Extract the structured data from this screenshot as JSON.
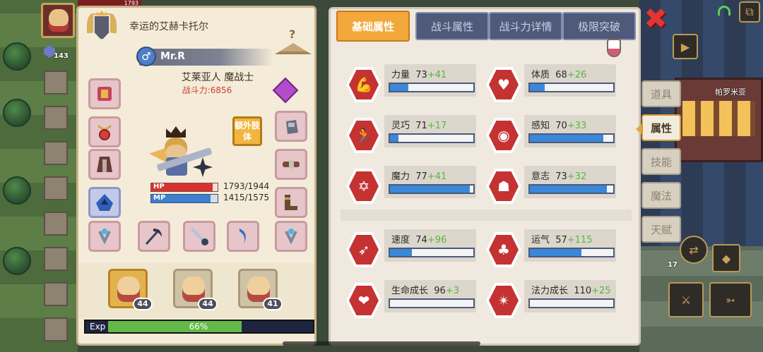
{
  "hud": {
    "top_hp_text": "1793",
    "level_badge": "143",
    "gold_count": "17",
    "map_label": "帕罗米亚"
  },
  "character": {
    "title": "幸运的艾赫卡托尔",
    "gender_symbol": "♂",
    "name": "Mr.R",
    "race_class": "艾莱亚人 魔战士",
    "power_label": "战斗力:6856",
    "extra_limb_label": "额外肢体",
    "hanger_symbol": "?",
    "hp_label": "HP",
    "hp_value": "1793/1944",
    "hp_fraction": 0.922,
    "mp_label": "MP",
    "mp_value": "1415/1575",
    "mp_fraction": 0.898,
    "party": [
      {
        "level": "44",
        "active": true
      },
      {
        "level": "44",
        "active": false
      },
      {
        "level": "41",
        "active": false
      }
    ],
    "exp_label": "Exp",
    "exp_percent": "66%",
    "exp_fraction": 0.66
  },
  "tabs": [
    {
      "label": "基础属性",
      "active": true
    },
    {
      "label": "战斗属性",
      "active": false
    },
    {
      "label": "战斗力详情",
      "active": false
    },
    {
      "label": "极限突破",
      "active": false
    }
  ],
  "close_symbol": "✖",
  "stats": [
    {
      "name": "力量",
      "base": "73",
      "bonus": "+41",
      "fill": 0.22,
      "icon": "muscle-icon",
      "glyph": "💪"
    },
    {
      "name": "体质",
      "base": "68",
      "bonus": "+26",
      "fill": 0.18,
      "icon": "heart-body-icon",
      "glyph": "♥"
    },
    {
      "name": "灵巧",
      "base": "71",
      "bonus": "+17",
      "fill": 0.1,
      "icon": "running-man-icon",
      "glyph": "🏃"
    },
    {
      "name": "感知",
      "base": "70",
      "bonus": "+33",
      "fill": 0.88,
      "icon": "eye-icon",
      "glyph": "◉"
    },
    {
      "name": "魔力",
      "base": "77",
      "bonus": "+41",
      "fill": 0.96,
      "icon": "hexagram-icon",
      "glyph": "✡"
    },
    {
      "name": "意志",
      "base": "73",
      "bonus": "+32",
      "fill": 0.92,
      "icon": "head-will-icon",
      "glyph": "☗"
    },
    {
      "name": "速度",
      "base": "74",
      "bonus": "+96",
      "fill": 0.26,
      "icon": "speed-wing-icon",
      "glyph": "➶"
    },
    {
      "name": "运气",
      "base": "57",
      "bonus": "+115",
      "fill": 0.62,
      "icon": "clover-icon",
      "glyph": "♣"
    },
    {
      "name": "生命成长",
      "base": "96",
      "bonus": "+3",
      "fill": 0.0,
      "icon": "life-growth-icon",
      "glyph": "❤"
    },
    {
      "name": "法力成长",
      "base": "110",
      "bonus": "+25",
      "fill": 0.0,
      "icon": "mana-growth-icon",
      "glyph": "✴"
    }
  ],
  "side_tabs": [
    {
      "label": "道具",
      "active": false
    },
    {
      "label": "属性",
      "active": true
    },
    {
      "label": "技能",
      "active": false
    },
    {
      "label": "魔法",
      "active": false
    },
    {
      "label": "天赋",
      "active": false
    }
  ],
  "colors": {
    "accent_orange": "#f2a83a",
    "bonus_green": "#56b83e",
    "power_red": "#d13a3a",
    "bar_blue": "#3b87d8",
    "stat_icon_red": "#c53232"
  }
}
